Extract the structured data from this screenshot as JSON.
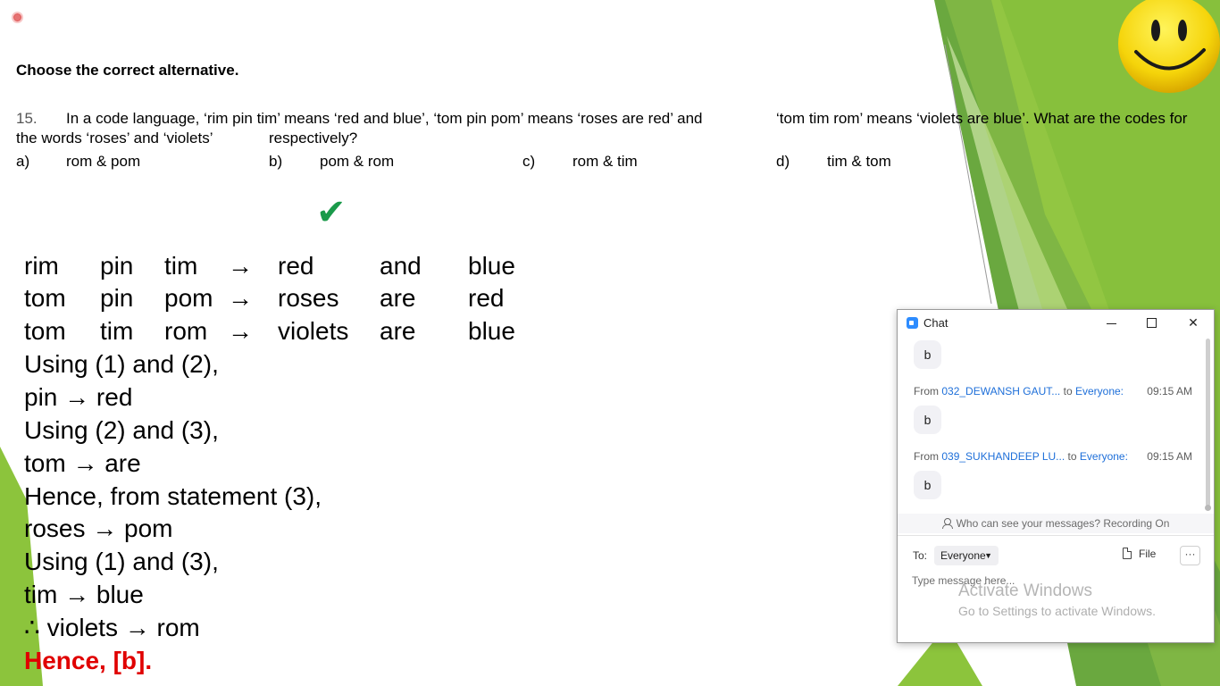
{
  "slide": {
    "heading": "Choose the correct alternative.",
    "question": {
      "number": "15.",
      "text_line1_a": "In a code language, ‘rim pin tim’ means ‘red and blue’, ‘tom pin pom’ means ‘roses are red’ and",
      "text_line1_b": "‘tom tim rom’ means ‘violets are blue’. What are the codes for",
      "text_line2_a": "the words ‘roses’ and ‘violets’",
      "text_line2_b": "respectively?"
    },
    "options": [
      {
        "key": "a)",
        "text": "rom & pom"
      },
      {
        "key": "b)",
        "text": "pom & rom"
      },
      {
        "key": "c)",
        "text": "rom & tim"
      },
      {
        "key": "d)",
        "text": "tim & tom"
      }
    ],
    "correct_mark": "✔",
    "code_rows": [
      [
        "rim",
        "pin",
        "tim",
        "→",
        "red",
        "and",
        "blue"
      ],
      [
        "tom",
        "pin",
        "pom",
        "→",
        "roses",
        "are",
        "red"
      ],
      [
        "tom",
        "tim",
        "rom",
        "→",
        "violets",
        "are",
        "blue"
      ]
    ],
    "solution_steps": [
      "Using (1) and (2),",
      "pin → red",
      "Using (2) and (3),",
      "tom → are",
      "Hence, from statement (3),",
      "roses → pom",
      "Using (1) and (3),",
      "tim → blue",
      "∴ violets → rom"
    ],
    "answer": "Hence, [b].",
    "colors": {
      "answer": "#e00000",
      "check": "#1a9a4a",
      "green_dark": "#5e9b3a",
      "green_light": "#9ccf45"
    }
  },
  "chat": {
    "title": "Chat",
    "window_controls": [
      "minimize-icon",
      "maximize-icon",
      "close-icon"
    ],
    "messages": [
      {
        "bubble": "b"
      },
      {
        "from_label": "From",
        "sender": "032_DEWANSH GAUT...",
        "to_label": "to",
        "recipient": "Everyone:",
        "time": "09:15 AM",
        "bubble": "b"
      },
      {
        "from_label": "From",
        "sender": "039_SUKHANDEEP LU...",
        "to_label": "to",
        "recipient": "Everyone:",
        "time": "09:15 AM",
        "bubble": "b"
      }
    ],
    "privacy_text": "Who can see your messages? Recording On",
    "to_label": "To:",
    "to_value": "Everyone",
    "file_label": "File",
    "more_label": "···",
    "input_placeholder": "Type message here..."
  },
  "watermark": {
    "line1": "Activate Windows",
    "line2": "Go to Settings to activate Windows."
  }
}
